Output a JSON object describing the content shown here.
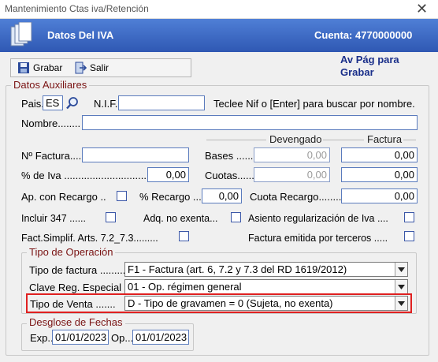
{
  "window": {
    "title": "Mantenimiento Ctas iva/Retención",
    "close": "✕"
  },
  "header": {
    "title": "Datos Del IVA",
    "cuenta": "Cuenta: 4770000000"
  },
  "toolbar": {
    "save_label": "Grabar",
    "exit_label": "Salir"
  },
  "hint": "Av Pág para Grabar",
  "aux": {
    "title": "Datos Auxiliares",
    "pais_label": "Pais.",
    "pais_value": "ES",
    "nif_label": "N.I.F.",
    "nif_value": "",
    "nif_hint": "Teclee Nif o [Enter] para buscar por nombre.",
    "nombre_label": "Nombre........",
    "nombre_value": "",
    "devengado_header": "Devengado",
    "factura_header": "Factura",
    "num_factura_label": "Nº Factura..........",
    "num_factura_value": "",
    "bases_label": "Bases ........",
    "bases_devengado": "0,00",
    "bases_factura": "0,00",
    "iva_label": "% de Iva ..............................",
    "iva_value": "0,00",
    "cuotas_label": "Cuotas.......",
    "cuotas_devengado": "0,00",
    "cuotas_factura": "0,00",
    "ap_recargo_label": "Ap. con Recargo ..",
    "pct_recargo_label": "% Recargo ....",
    "pct_recargo_value": "0,00",
    "cuota_recargo_label": "Cuota Recargo..........",
    "cuota_recargo_value": "0,00",
    "incluir347_label": "Incluir 347 ......",
    "adq_label": "Adq. no exenta...",
    "asiento_label": "Asiento regularización de Iva ....",
    "fact_simpl_label": "Fact.Simplif. Arts. 7.2_7.3.........",
    "fact_terceros_label": "Factura emitida por terceros ....."
  },
  "operacion": {
    "title": "Tipo de Operación",
    "tipo_factura_label": "Tipo de factura .........",
    "tipo_factura_value": "F1 - Factura (art. 6, 7.2 y 7.3 del RD 1619/2012)",
    "clave_label": "Clave Reg. Especial ...",
    "clave_value": "01 - Op. régimen general",
    "tipo_venta_label": "Tipo de Venta .......",
    "tipo_venta_value": "D - Tipo de gravamen = 0 (Sujeta, no exenta)"
  },
  "fechas": {
    "title": "Desglose de Fechas",
    "exp_label": "Exp..",
    "exp_value": "01/01/2023",
    "op_label": "Op...",
    "op_value": "01/01/2023"
  },
  "colors": {
    "banner": "#3a67c4",
    "highlight": "#e02020",
    "group_title": "#7a1414"
  }
}
